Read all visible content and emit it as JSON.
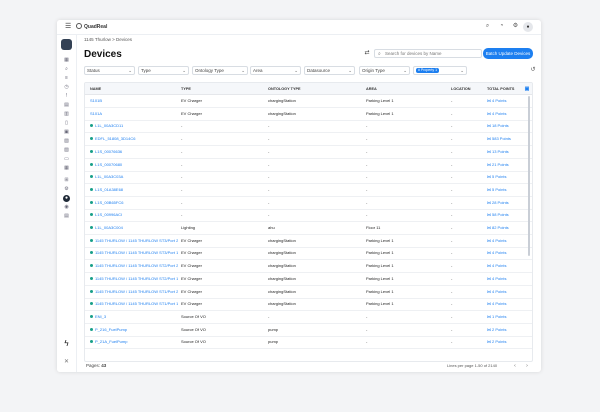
{
  "brand": {
    "name": "QuadReal"
  },
  "breadcrumb": {
    "parent": "1145 Thurlow",
    "separator": ">",
    "current": "Devices"
  },
  "page": {
    "title": "Devices"
  },
  "search": {
    "placeholder": "Search for devices by Name"
  },
  "actions": {
    "batch_update": "Batch Update Devices"
  },
  "filters": {
    "status": "Status",
    "type": "Type",
    "ontology_type": "Ontology Type",
    "area": "Area",
    "datasource": "Datasource",
    "origin_type": "Origin Type",
    "chip": "# Property 1"
  },
  "table": {
    "headers": [
      "NAME",
      "TYPE",
      "ONTOLOGY TYPE",
      "AREA",
      "LOCATION",
      "TOTAL POINTS"
    ]
  },
  "rows": [
    {
      "name": "S101B",
      "type": "EV Charger",
      "ontology": "chargingStation",
      "area": "Parking Level 1",
      "location": "-",
      "points": "4 Points",
      "dot": false
    },
    {
      "name": "S101A",
      "type": "EV Charger",
      "ontology": "chargingStation",
      "area": "Parking Level 1",
      "location": "-",
      "points": "4 Points",
      "dot": false
    },
    {
      "name": "L1L_00A3CD11",
      "type": "-",
      "ontology": "-",
      "area": "-",
      "location": "-",
      "points": "18 Points",
      "dot": true
    },
    {
      "name": "EDFL_51808_3D14C6",
      "type": "-",
      "ontology": "-",
      "area": "-",
      "location": "-",
      "points": "583 Points",
      "dot": true
    },
    {
      "name": "L1S_00076636",
      "type": "-",
      "ontology": "-",
      "area": "-",
      "location": "-",
      "points": "13 Points",
      "dot": true
    },
    {
      "name": "L1S_00070680",
      "type": "-",
      "ontology": "-",
      "area": "-",
      "location": "-",
      "points": "21 Points",
      "dot": true
    },
    {
      "name": "L1L_00A3C03A",
      "type": "-",
      "ontology": "-",
      "area": "-",
      "location": "-",
      "points": "5 Points",
      "dot": true
    },
    {
      "name": "L1S_01A38E68",
      "type": "-",
      "ontology": "-",
      "area": "-",
      "location": "-",
      "points": "5 Points",
      "dot": true
    },
    {
      "name": "L1S_00B65FC6",
      "type": "-",
      "ontology": "-",
      "area": "-",
      "location": "-",
      "points": "28 Points",
      "dot": true
    },
    {
      "name": "L1S_00996ACI",
      "type": "-",
      "ontology": "-",
      "area": "-",
      "location": "-",
      "points": "58 Points",
      "dot": true
    },
    {
      "name": "L1L_00A3C004",
      "type": "Lighting",
      "ontology": "ahu",
      "area": "Floor 11",
      "location": "-",
      "points": "82 Points",
      "dot": true
    },
    {
      "name": "1145 THURLOW / 1145 THURLOW ST3/Port 2",
      "type": "EV Charger",
      "ontology": "chargingStation",
      "area": "Parking Level 1",
      "location": "-",
      "points": "4 Points",
      "dot": true
    },
    {
      "name": "1145 THURLOW / 1145 THURLOW ST3/Port 1",
      "type": "EV Charger",
      "ontology": "chargingStation",
      "area": "Parking Level 1",
      "location": "-",
      "points": "4 Points",
      "dot": true
    },
    {
      "name": "1145 THURLOW / 1145 THURLOW ST2/Port 2",
      "type": "EV Charger",
      "ontology": "chargingStation",
      "area": "Parking Level 1",
      "location": "-",
      "points": "4 Points",
      "dot": true
    },
    {
      "name": "1145 THURLOW / 1145 THURLOW ST2/Port 1",
      "type": "EV Charger",
      "ontology": "chargingStation",
      "area": "Parking Level 1",
      "location": "-",
      "points": "4 Points",
      "dot": true
    },
    {
      "name": "1145 THURLOW / 1145 THURLOW ST1/Port 2",
      "type": "EV Charger",
      "ontology": "chargingStation",
      "area": "Parking Level 1",
      "location": "-",
      "points": "4 Points",
      "dot": true
    },
    {
      "name": "1145 THURLOW / 1145 THURLOW ST1/Port 1",
      "type": "EV Charger",
      "ontology": "chargingStation",
      "area": "Parking Level 1",
      "location": "-",
      "points": "4 Points",
      "dot": true
    },
    {
      "name": "ENI_3",
      "type": "Source Of VO",
      "ontology": "-",
      "area": "-",
      "location": "-",
      "points": "1 Points",
      "dot": true
    },
    {
      "name": "P_216_FuelPump",
      "type": "Source Of VO",
      "ontology": "pump",
      "area": "-",
      "location": "-",
      "points": "2 Points",
      "dot": true
    },
    {
      "name": "P_21A_FuelPump",
      "type": "Source Of VO",
      "ontology": "pump",
      "area": "-",
      "location": "-",
      "points": "2 Points",
      "dot": true
    }
  ],
  "footer": {
    "pages_label": "Pages:",
    "pages_value": "43",
    "lines_text": "Lines per page 1-50 of 2140"
  },
  "colors": {
    "accent": "#1d7ff0",
    "status_dot": "#19a089"
  }
}
